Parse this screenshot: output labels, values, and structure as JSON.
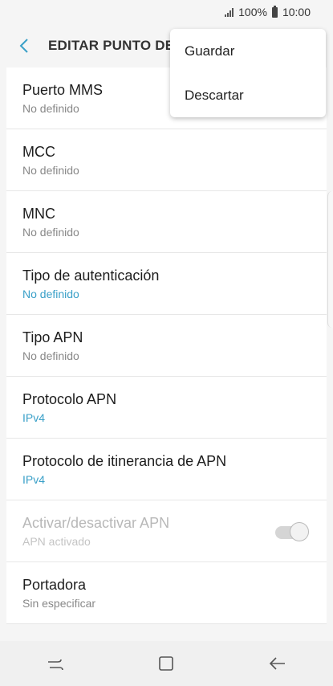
{
  "status": {
    "battery_text": "100%",
    "time": "10:00"
  },
  "header": {
    "title": "EDITAR PUNTO DE"
  },
  "menu": {
    "items": [
      "Guardar",
      "Descartar"
    ]
  },
  "rows": [
    {
      "title": "Puerto MMS",
      "sub": "No definido"
    },
    {
      "title": "MCC",
      "sub": "No definido"
    },
    {
      "title": "MNC",
      "sub": "No definido"
    },
    {
      "title": "Tipo de autenticación",
      "sub": "No definido"
    },
    {
      "title": "Tipo APN",
      "sub": "No definido"
    },
    {
      "title": "Protocolo APN",
      "sub": "IPv4"
    },
    {
      "title": "Protocolo de itinerancia de APN",
      "sub": "IPv4"
    },
    {
      "title": "Activar/desactivar APN",
      "sub": "APN activado",
      "toggle_on": true
    },
    {
      "title": "Portadora",
      "sub": "Sin especificar"
    }
  ],
  "colors": {
    "accent": "#3aa0c8",
    "back_arrow": "#3aa0c8"
  },
  "icons": {
    "back": "back-arrow-icon",
    "recent": "recent-apps-icon",
    "home": "home-icon",
    "nav_back": "nav-back-icon"
  }
}
